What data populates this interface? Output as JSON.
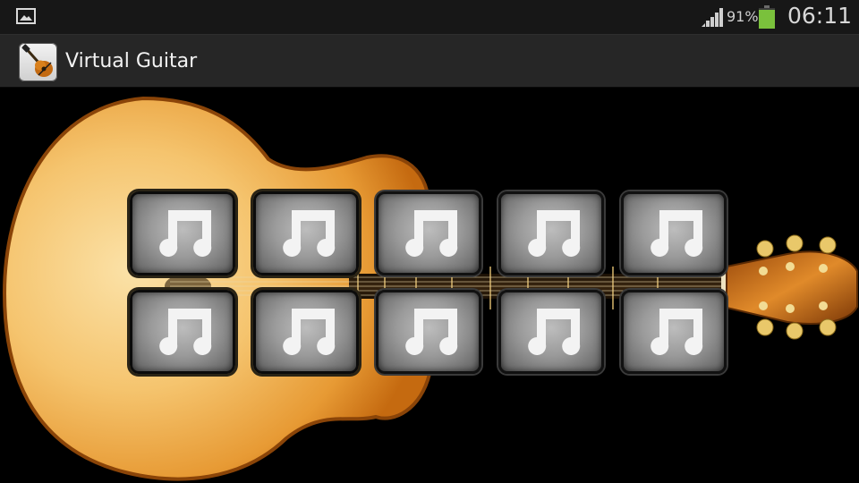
{
  "status_bar": {
    "battery_percent": "91%",
    "time": "06:11",
    "icons": [
      "gallery-notification-icon",
      "signal-icon",
      "battery-icon"
    ]
  },
  "action_bar": {
    "title": "Virtual Guitar",
    "icon": "guitar-app-icon"
  },
  "pads": {
    "count": 10,
    "icon": "music-note-icon"
  },
  "colors": {
    "status_bar": "#171717",
    "action_bar": "#262626",
    "background": "#000000",
    "guitar_body": "#f0b65a",
    "pad": "#9a9a9a",
    "battery_level": "#7ac13c"
  }
}
